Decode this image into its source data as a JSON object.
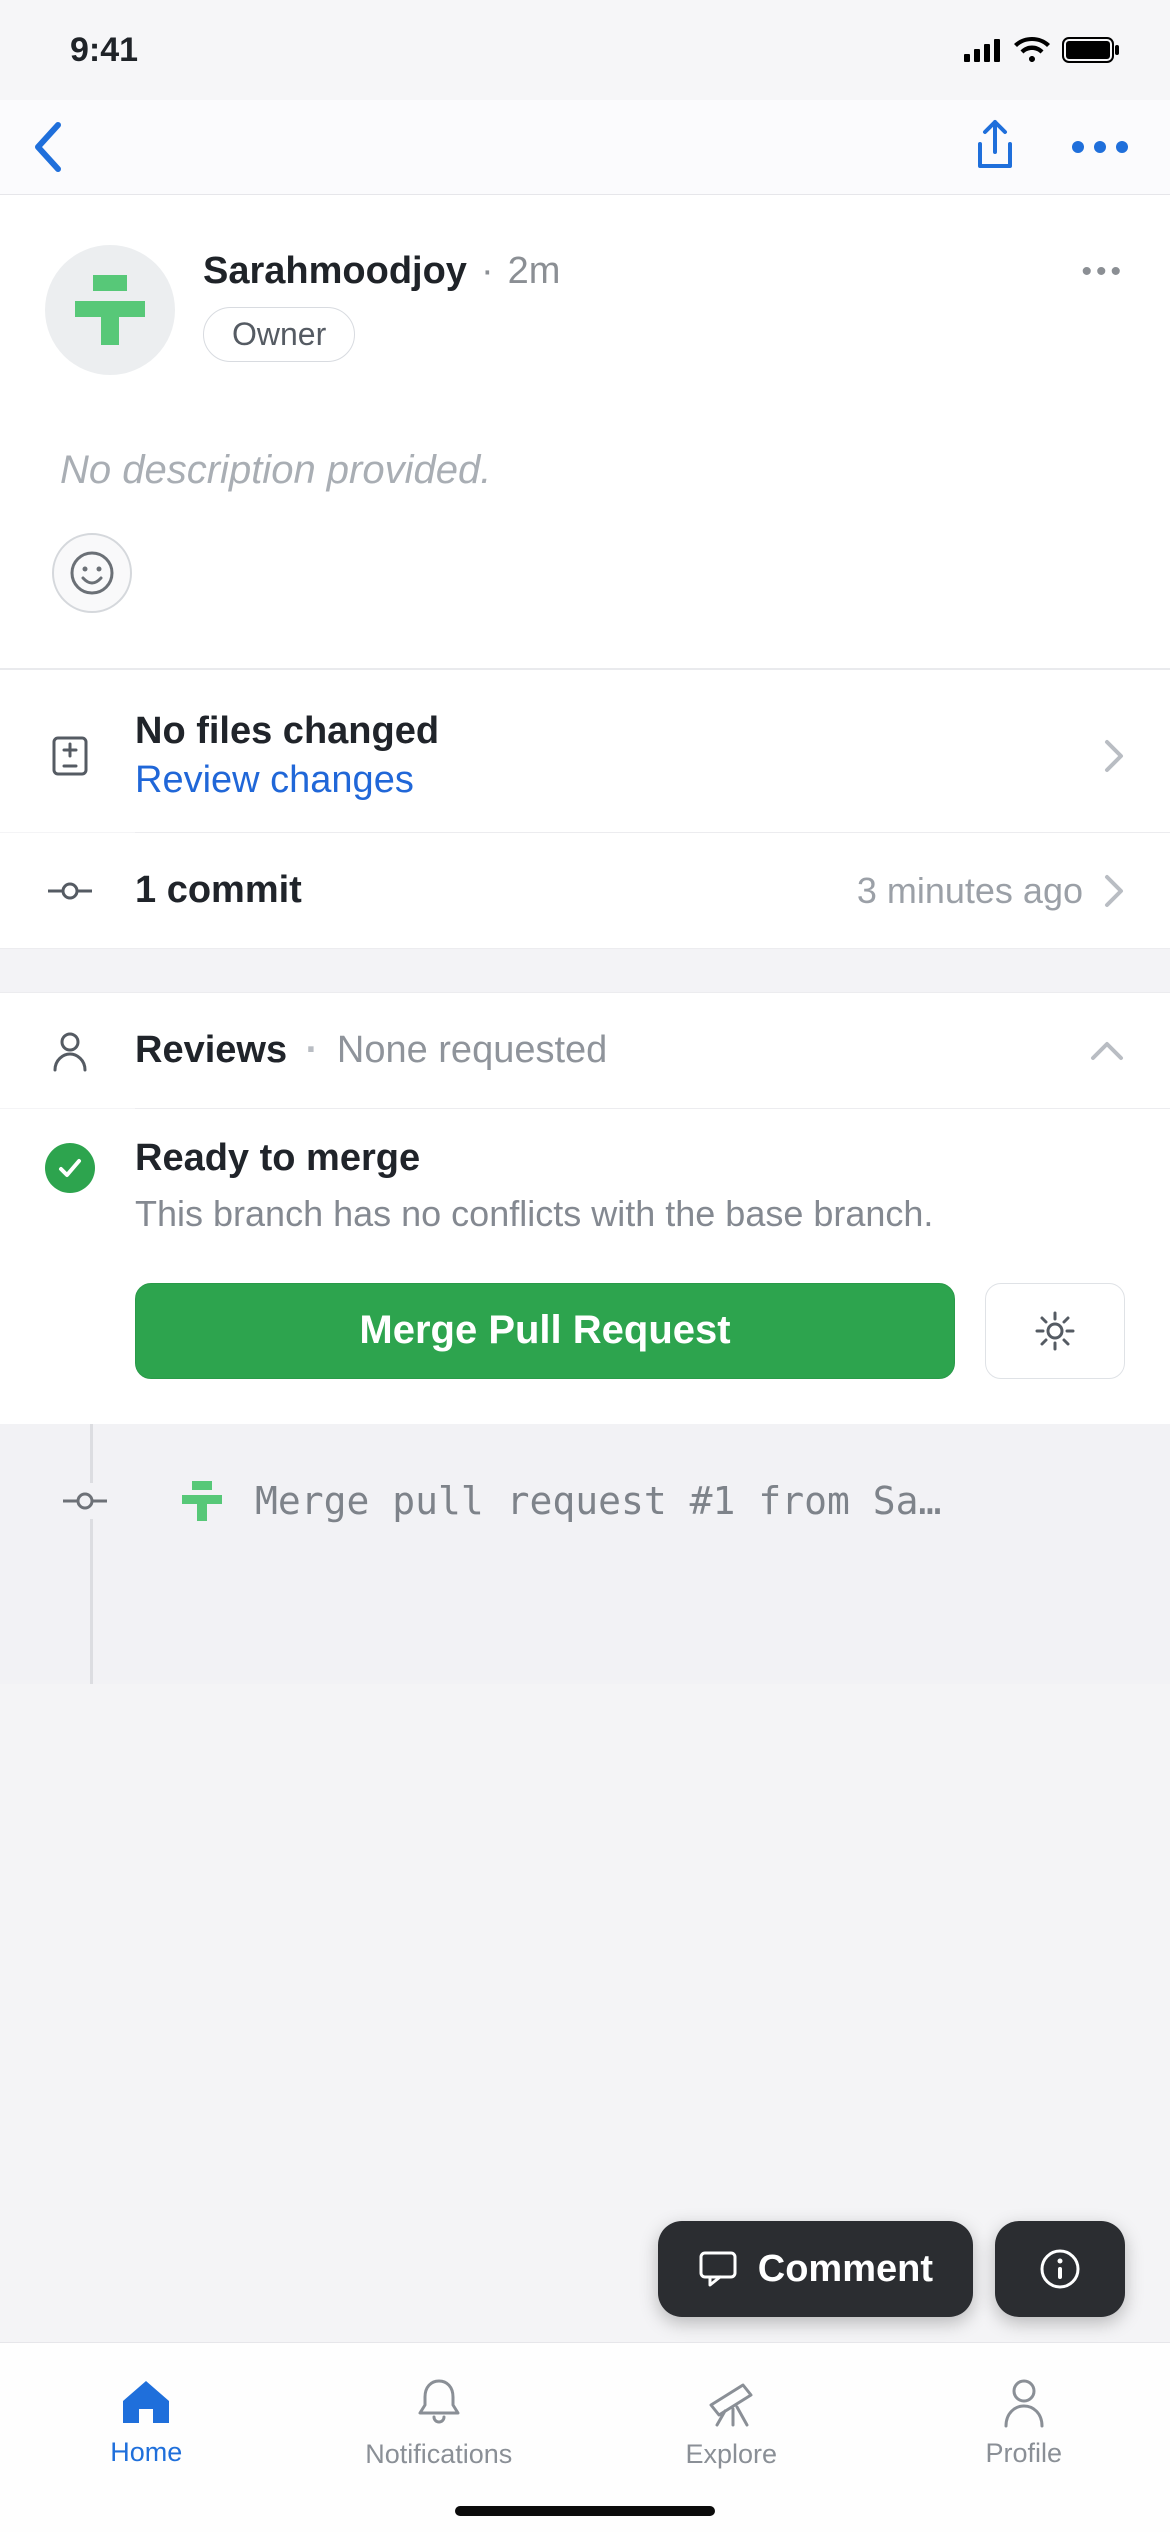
{
  "status_bar": {
    "time": "9:41"
  },
  "author": {
    "name": "Sarahmoodjoy",
    "time": "2m",
    "role_label": "Owner"
  },
  "description": "No description provided.",
  "files": {
    "title": "No files changed",
    "review_link": "Review changes"
  },
  "commits": {
    "title": "1 commit",
    "time": "3 minutes ago"
  },
  "reviews": {
    "title": "Reviews",
    "status": "None requested"
  },
  "merge": {
    "title": "Ready to merge",
    "subtitle": "This branch has no conflicts with the base branch.",
    "button": "Merge Pull Request"
  },
  "timeline": {
    "commit_message": "Merge pull request #1 from Sa…"
  },
  "floating": {
    "comment": "Comment"
  },
  "tabs": {
    "home": "Home",
    "notifications": "Notifications",
    "explore": "Explore",
    "profile": "Profile"
  }
}
